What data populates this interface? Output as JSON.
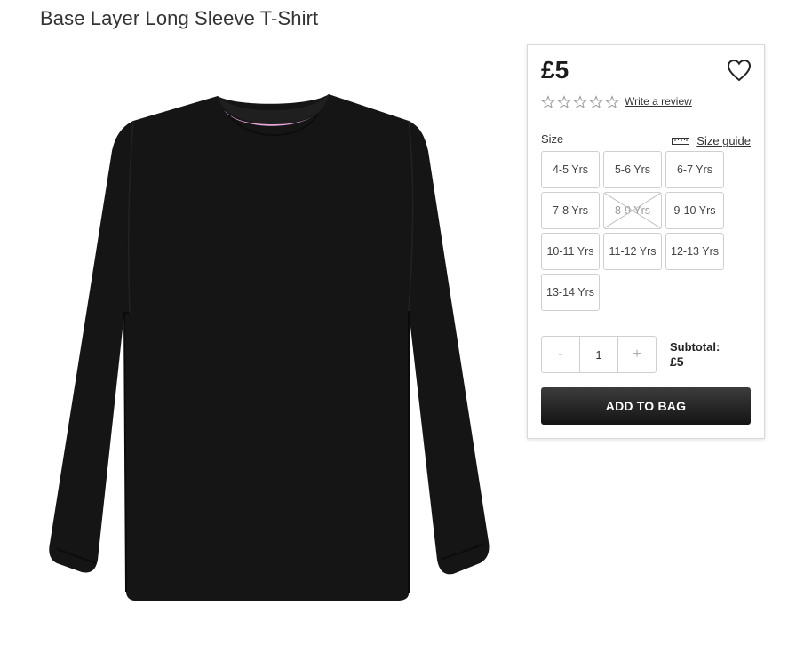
{
  "product": {
    "title": "Base Layer Long Sleeve T-Shirt",
    "price": "£5",
    "image_icon": "black-long-sleeve-tshirt"
  },
  "rating": {
    "stars": 5,
    "filled": 0,
    "review_link": "Write a review"
  },
  "size": {
    "label": "Size",
    "guide_label": "Size guide",
    "options": [
      {
        "label": "4-5 Yrs",
        "available": true
      },
      {
        "label": "5-6 Yrs",
        "available": true
      },
      {
        "label": "6-7 Yrs",
        "available": true
      },
      {
        "label": "7-8 Yrs",
        "available": true
      },
      {
        "label": "8-9 Yrs",
        "available": false
      },
      {
        "label": "9-10 Yrs",
        "available": true
      },
      {
        "label": "10-11 Yrs",
        "available": true
      },
      {
        "label": "11-12 Yrs",
        "available": true
      },
      {
        "label": "12-13 Yrs",
        "available": true
      },
      {
        "label": "13-14 Yrs",
        "available": true
      }
    ]
  },
  "quantity": {
    "decrement_label": "-",
    "value": "1",
    "increment_label": "+"
  },
  "subtotal": {
    "label": "Subtotal:",
    "value": "£5"
  },
  "actions": {
    "add_to_bag": "ADD TO BAG"
  },
  "colors": {
    "button_dark": "#1c1c1c",
    "border": "#cfcfcf",
    "shirt": "#141414",
    "collar_trim": "#e6a6d6"
  }
}
